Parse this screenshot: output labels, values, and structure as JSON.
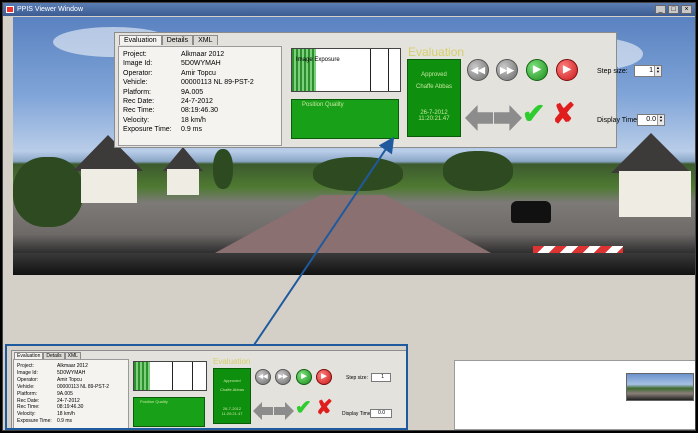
{
  "window": {
    "title": "PPIS Viewer Window",
    "controls": [
      "_",
      "□",
      "×"
    ]
  },
  "panel": {
    "tabs": [
      "Evaluation",
      "Details",
      "XML"
    ],
    "fields": [
      {
        "label": "Project:",
        "value": "Alkmaar 2012"
      },
      {
        "label": "Image Id:",
        "value": "5D0WYMAH"
      },
      {
        "label": "Operator:",
        "value": "Amir Topcu"
      },
      {
        "label": "Vehicle:",
        "value": "00000113 NL 89-PST-2"
      },
      {
        "label": "Platform:",
        "value": "9A.005"
      },
      {
        "label": "Rec Date:",
        "value": "24-7-2012"
      },
      {
        "label": "Rec Time:",
        "value": "08:19:46.30"
      },
      {
        "label": "Velocity:",
        "value": "18 km/h"
      },
      {
        "label": "Exposure Time:",
        "value": "0.9 ms"
      }
    ],
    "exposure_label": "Image Exposure",
    "exposure_level": 0.22,
    "quality_label": "Position Quality",
    "evaluation_title": "Evaluation",
    "status": {
      "state": "Approved",
      "user": "Chaffe Abbas",
      "date": "26-7-2012",
      "time": "11:20:21.47"
    },
    "step_size_label": "Step size:",
    "step_size_value": "1",
    "display_time_label": "Display Time:",
    "display_time_value": "0.0"
  },
  "colors": {
    "accent": "#1f5a9e",
    "ok_green": "#18a018",
    "reject_red": "#e01e1e",
    "eval_title": "#d6cf6a"
  },
  "icons": [
    "rewind-icon",
    "fast-forward-icon",
    "play-icon",
    "record-icon",
    "arrow-left-icon",
    "arrow-right-icon",
    "checkmark-icon",
    "cross-icon"
  ]
}
